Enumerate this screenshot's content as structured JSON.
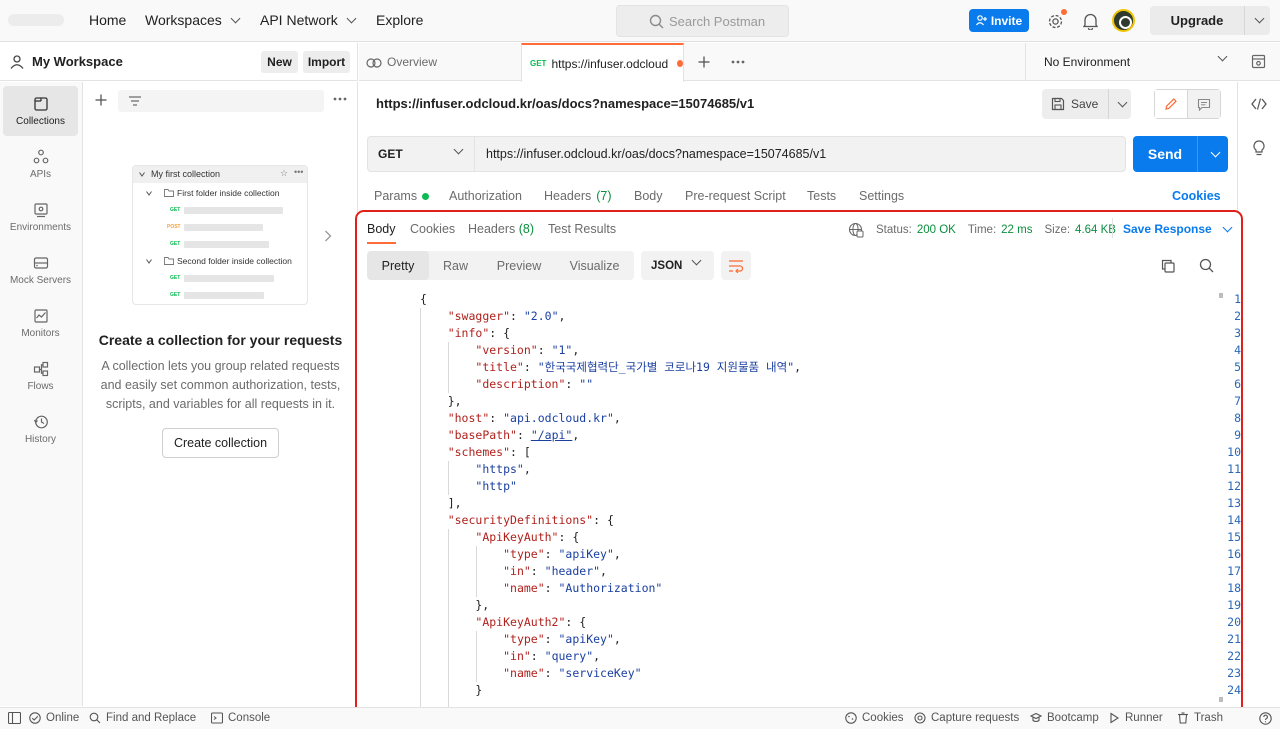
{
  "topbar": {
    "nav": [
      "Home",
      "Workspaces",
      "API Network",
      "Explore"
    ],
    "search_placeholder": "Search Postman",
    "invite_label": "Invite",
    "upgrade_label": "Upgrade"
  },
  "workspace": {
    "title": "My Workspace",
    "new_label": "New",
    "import_label": "Import"
  },
  "rail": [
    {
      "label": "Collections",
      "icon": "collections-icon",
      "active": true
    },
    {
      "label": "APIs",
      "icon": "apis-icon"
    },
    {
      "label": "Environments",
      "icon": "environments-icon"
    },
    {
      "label": "Mock Servers",
      "icon": "mock-servers-icon"
    },
    {
      "label": "Monitors",
      "icon": "monitors-icon"
    },
    {
      "label": "Flows",
      "icon": "flows-icon"
    },
    {
      "label": "History",
      "icon": "history-icon"
    }
  ],
  "illustration": {
    "collection": "My first collection",
    "folder1": "First folder inside collection",
    "folder2": "Second folder inside collection",
    "methods": [
      "GET",
      "POST",
      "GET",
      "GET",
      "GET"
    ]
  },
  "empty_state": {
    "title": "Create a collection for your requests",
    "description": "A collection lets you group related requests and easily set common authorization, tests, scripts, and variables for all requests in it.",
    "button": "Create collection"
  },
  "tabs": {
    "overview": "Overview",
    "active_method": "GET",
    "active_label": "https://infuser.odcloud",
    "environment": "No Environment"
  },
  "request": {
    "title": "https://infuser.odcloud.kr/oas/docs?namespace=15074685/v1",
    "save_label": "Save",
    "method": "GET",
    "url": "https://infuser.odcloud.kr/oas/docs?namespace=15074685/v1",
    "send_label": "Send",
    "tabs": [
      "Params",
      "Authorization",
      "Headers",
      "Body",
      "Pre-request Script",
      "Tests",
      "Settings"
    ],
    "headers_count": "(7)",
    "cookies_label": "Cookies"
  },
  "response": {
    "tabs": [
      "Body",
      "Cookies",
      "Headers",
      "Test Results"
    ],
    "headers_count": "(8)",
    "status_label": "Status:",
    "status_value": "200 OK",
    "time_label": "Time:",
    "time_value": "22 ms",
    "size_label": "Size:",
    "size_value": "4.64 KB",
    "save_response": "Save Response",
    "views": [
      "Pretty",
      "Raw",
      "Preview",
      "Visualize"
    ],
    "format": "JSON"
  },
  "code_lines": [
    "{",
    "    \"swagger\": \"2.0\",",
    "    \"info\": {",
    "        \"version\": \"1\",",
    "        \"title\": \"한국국제협력단_국가별 코로나19 지원물품 내역\",",
    "        \"description\": \"\"",
    "    },",
    "    \"host\": \"api.odcloud.kr\",",
    "    \"basePath\": \"/api\",",
    "    \"schemes\": [",
    "        \"https\",",
    "        \"http\"",
    "    ],",
    "    \"securityDefinitions\": {",
    "        \"ApiKeyAuth\": {",
    "            \"type\": \"apiKey\",",
    "            \"in\": \"header\",",
    "            \"name\": \"Authorization\"",
    "        },",
    "        \"ApiKeyAuth2\": {",
    "            \"type\": \"apiKey\",",
    "            \"in\": \"query\",",
    "            \"name\": \"serviceKey\"",
    "        }"
  ],
  "statusbar": {
    "online": "Online",
    "find_replace": "Find and Replace",
    "console": "Console",
    "cookies": "Cookies",
    "capture": "Capture requests",
    "bootcamp": "Bootcamp",
    "runner": "Runner",
    "trash": "Trash"
  },
  "colors": {
    "accent": "#ff6c37",
    "primary": "#097bed",
    "success": "#0a8f3e",
    "highlight_border": "#e0201b"
  }
}
